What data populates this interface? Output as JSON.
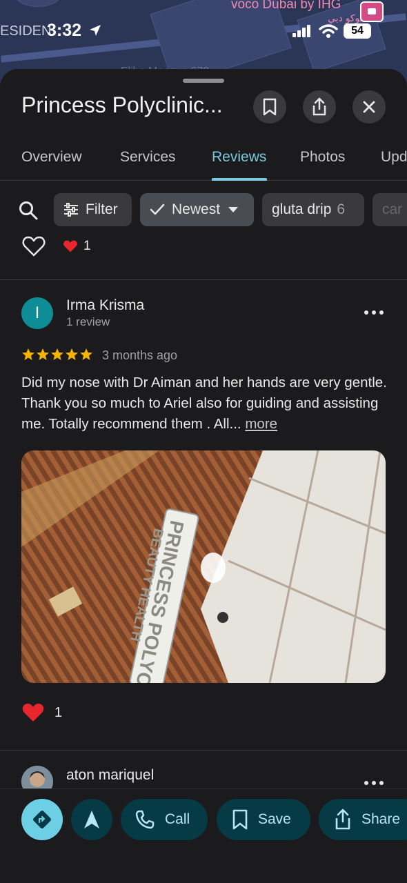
{
  "status_bar": {
    "carrier_fragment": "ESIDEN",
    "time": "3:32",
    "battery": "54"
  },
  "map": {
    "poi_label": "voco Dubai by IHG",
    "poi_label_secondary": "فوكو دبي",
    "faded_label": "Eliba Mosque  678"
  },
  "place": {
    "title": "Princess Polyclinic..."
  },
  "tabs": [
    {
      "label": "Overview",
      "active": false
    },
    {
      "label": "Services",
      "active": false
    },
    {
      "label": "Reviews",
      "active": true
    },
    {
      "label": "Photos",
      "active": false
    },
    {
      "label": "Upd",
      "active": false
    }
  ],
  "chips": {
    "filter": "Filter",
    "newest": "Newest",
    "gluta": {
      "label": "gluta drip",
      "count": "6"
    },
    "more": "car"
  },
  "previous_review": {
    "reaction_count": "1"
  },
  "review": {
    "avatar_letter": "I",
    "author": "Irma Krisma",
    "meta": "1 review",
    "rating": 5,
    "date": "3 months ago",
    "text": "Did my nose with Dr Aiman and her hands are very gentle. Thank you so much to Ariel also for guiding and assisting me. Totally recommend them . All...",
    "more_link": "more",
    "photo_sign_line1": "PRINCESS POLYCLI",
    "photo_sign_line2": "BEAUTY HEALTH",
    "reaction_count": "1"
  },
  "next_review": {
    "author": "aton mariquel"
  },
  "actions": {
    "call": "Call",
    "save": "Save",
    "share": "Share"
  },
  "colors": {
    "accent": "#7cc9dd",
    "star": "#f5b400",
    "action_pill": "#063a44",
    "avatar": "#0f8d96"
  }
}
